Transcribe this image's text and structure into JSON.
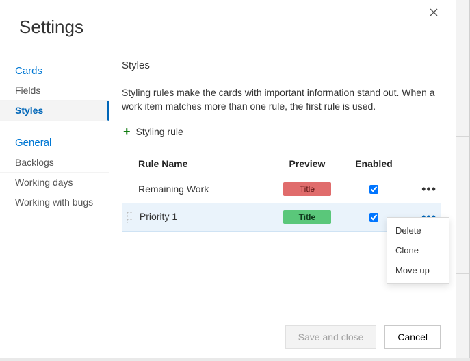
{
  "title": "Settings",
  "sidebar": {
    "groups": [
      {
        "label": "Cards",
        "items": [
          {
            "label": "Fields",
            "selected": false
          },
          {
            "label": "Styles",
            "selected": true
          }
        ]
      },
      {
        "label": "General",
        "items": [
          {
            "label": "Backlogs",
            "selected": false
          },
          {
            "label": "Working days",
            "selected": false
          },
          {
            "label": "Working with bugs",
            "selected": false
          }
        ]
      }
    ]
  },
  "content": {
    "heading": "Styles",
    "description": "Styling rules make the cards with important information stand out. When a work item matches more than one rule, the first rule is used.",
    "add_rule_label": "Styling rule",
    "columns": {
      "name": "Rule Name",
      "preview": "Preview",
      "enabled": "Enabled"
    },
    "preview_text": "Title",
    "rules": [
      {
        "name": "Remaining Work",
        "color": "red",
        "enabled": true,
        "selected": false
      },
      {
        "name": "Priority 1",
        "color": "green",
        "enabled": true,
        "selected": true
      }
    ]
  },
  "menu": {
    "items": [
      {
        "label": "Delete"
      },
      {
        "label": "Clone"
      },
      {
        "label": "Move up"
      }
    ]
  },
  "footer": {
    "save": "Save and close",
    "cancel": "Cancel"
  }
}
